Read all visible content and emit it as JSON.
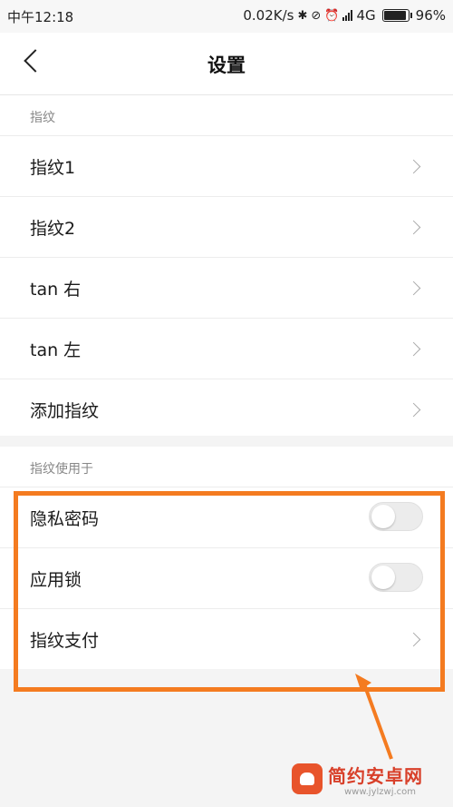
{
  "status_bar": {
    "time": "中午12:18",
    "network_speed": "0.02K/s",
    "network_type": "4G",
    "battery": "96%",
    "icons": [
      "bluetooth-icon",
      "mute-icon",
      "alarm-icon",
      "hd-icon",
      "signal-icon",
      "battery-icon"
    ]
  },
  "header": {
    "title": "设置",
    "back_icon": "back-arrow-icon"
  },
  "fingerprint_section": {
    "label": "指纹",
    "items": [
      {
        "label": "指纹1"
      },
      {
        "label": "指纹2"
      },
      {
        "label": "tan 右"
      },
      {
        "label": "tan 左"
      },
      {
        "label": "添加指纹"
      }
    ]
  },
  "usage_section": {
    "label": "指纹使用于",
    "items": [
      {
        "label": "隐私密码",
        "control": "toggle",
        "on": false
      },
      {
        "label": "应用锁",
        "control": "toggle",
        "on": false
      },
      {
        "label": "指纹支付",
        "control": "chevron"
      }
    ]
  },
  "annotation": {
    "color": "#f47b20"
  },
  "watermark": {
    "brand": "简约安卓网",
    "url": "www.jylzwj.com"
  }
}
